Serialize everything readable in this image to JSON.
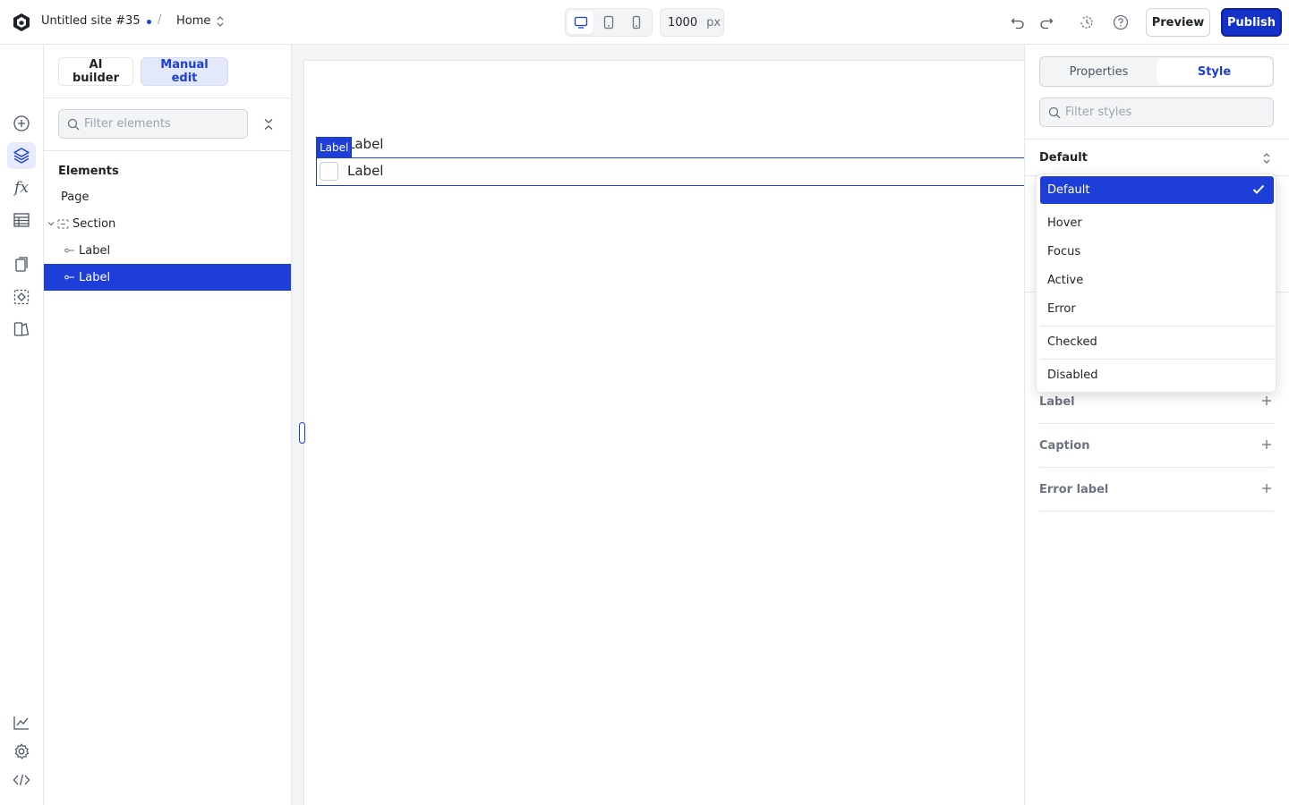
{
  "topbar": {
    "site_name": "Untitled site #35",
    "separator": "/",
    "page_name": "Home",
    "width_value": "1000",
    "width_unit": "px",
    "preview_label": "Preview",
    "publish_label": "Publish"
  },
  "modes": {
    "ai_label": "AI builder",
    "manual_label": "Manual edit",
    "active": "manual"
  },
  "elements_panel": {
    "filter_placeholder": "Filter elements",
    "title": "Elements",
    "tree": [
      {
        "label": "Page",
        "depth": 0,
        "selected": false
      },
      {
        "label": "Section",
        "depth": 1,
        "selected": false
      },
      {
        "label": "Label",
        "depth": 2,
        "selected": false
      },
      {
        "label": "Label",
        "depth": 2,
        "selected": true
      }
    ]
  },
  "canvas": {
    "top_label": "Label",
    "selection_tag": "Label",
    "checkbox_label": "Label"
  },
  "right_panel": {
    "tabs": [
      "Properties",
      "Style"
    ],
    "active_tab": "Style",
    "filter_placeholder": "Filter styles",
    "state": "Default",
    "sections": [
      "Label",
      "Caption",
      "Error label"
    ]
  },
  "state_dropdown": {
    "options": [
      "Default",
      "Hover",
      "Focus",
      "Active",
      "Error",
      "Checked",
      "Disabled"
    ],
    "selected": "Default"
  },
  "colors": {
    "accent": "#1d3fd8",
    "publish": "#1431c8",
    "border": "#e5e7eb"
  }
}
